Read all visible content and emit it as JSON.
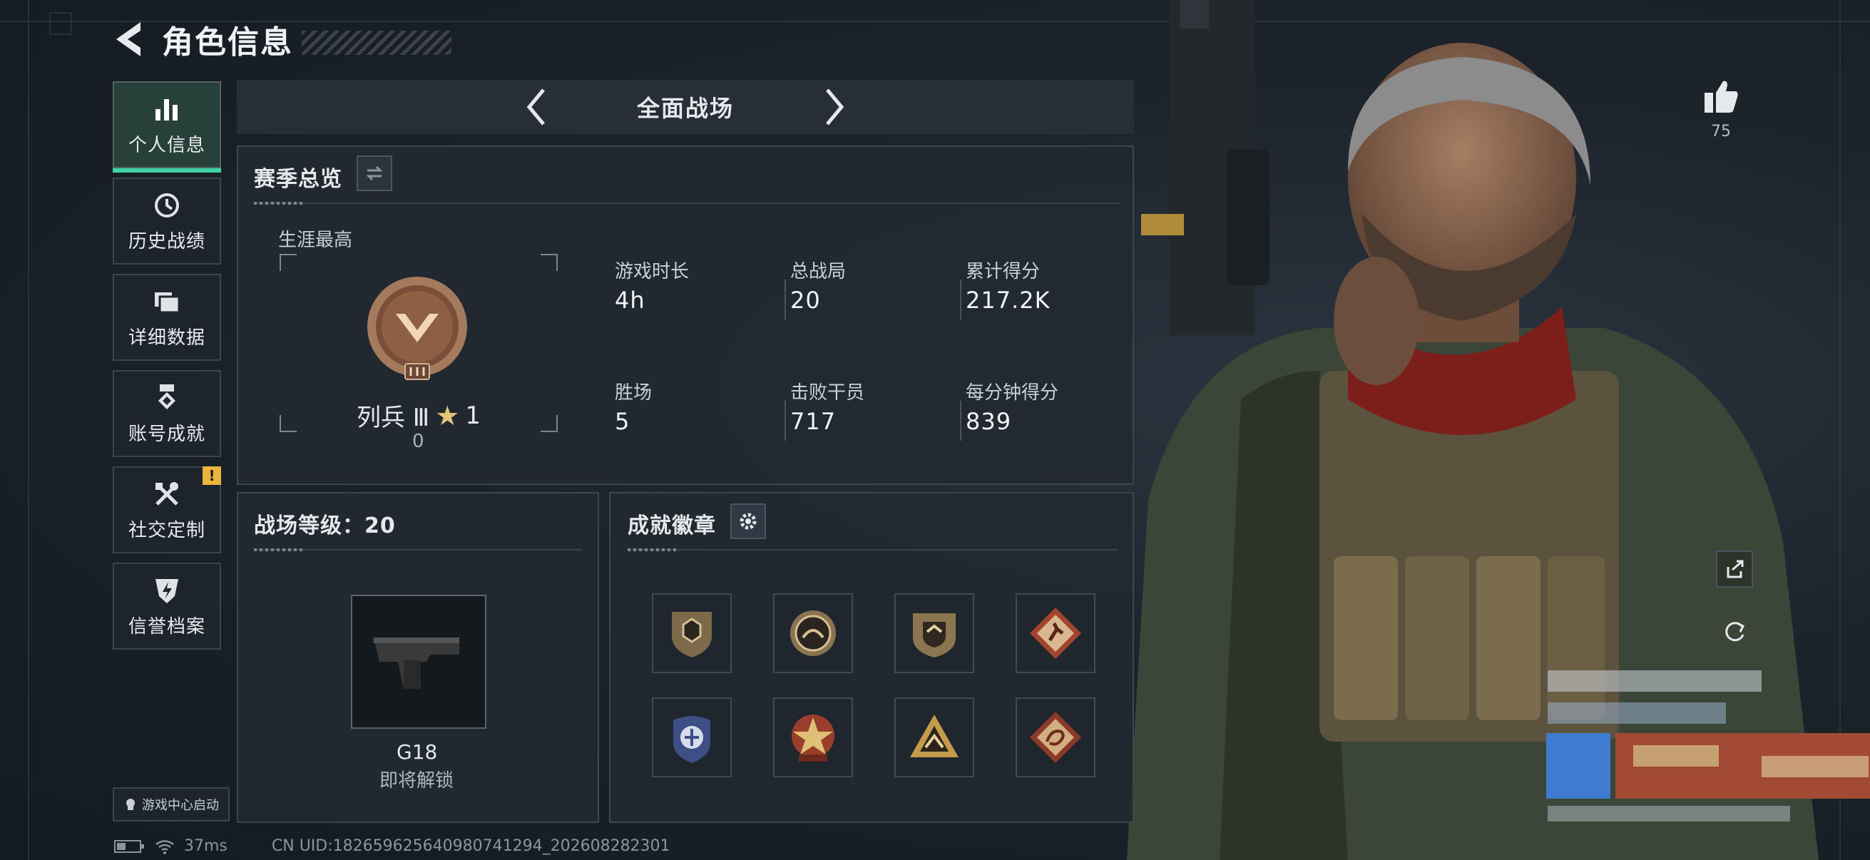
{
  "header": {
    "title": "角色信息"
  },
  "sidebar": {
    "items": [
      {
        "label": "个人信息",
        "icon": "bar-chart-icon",
        "active": true
      },
      {
        "label": "历史战绩",
        "icon": "history-clock-icon"
      },
      {
        "label": "详细数据",
        "icon": "folder-icon"
      },
      {
        "label": "账号成就",
        "icon": "medal-icon"
      },
      {
        "label": "社交定制",
        "icon": "tools-icon",
        "badge": "!"
      },
      {
        "label": "信誉档案",
        "icon": "shield-lightning-icon"
      }
    ],
    "game_center_label": "游戏中心启动"
  },
  "mode_selector": {
    "title": "全面战场"
  },
  "season_overview": {
    "title": "赛季总览",
    "career_best_label": "生涯最高",
    "rank": {
      "name": "列兵 Ⅲ",
      "stars": "1",
      "points": "0"
    },
    "stats": [
      {
        "label": "游戏时长",
        "value": "4h"
      },
      {
        "label": "总战局",
        "value": "20"
      },
      {
        "label": "累计得分",
        "value": "217.2K"
      },
      {
        "label": "胜场",
        "value": "5"
      },
      {
        "label": "击败干员",
        "value": "717"
      },
      {
        "label": "每分钟得分",
        "value": "839"
      }
    ]
  },
  "battlefield_level": {
    "title": "战场等级：20",
    "weapon_name": "G18",
    "weapon_status": "即将解锁"
  },
  "achievements": {
    "title": "成就徽章",
    "badges": [
      "badge-shield-icon",
      "badge-circle-icon",
      "badge-emblem-icon",
      "badge-diamond-runner-icon",
      "badge-police-icon",
      "badge-star-icon",
      "badge-triangle-icon",
      "badge-dragon-icon"
    ]
  },
  "likes": {
    "count": "75"
  },
  "status_bar": {
    "ping": "37ms",
    "uid": "CN UID:18265962564098074129​4_202608282301"
  },
  "colors": {
    "accent": "#3fd3a5",
    "warning": "#e9b53b",
    "panel": "#222931"
  }
}
